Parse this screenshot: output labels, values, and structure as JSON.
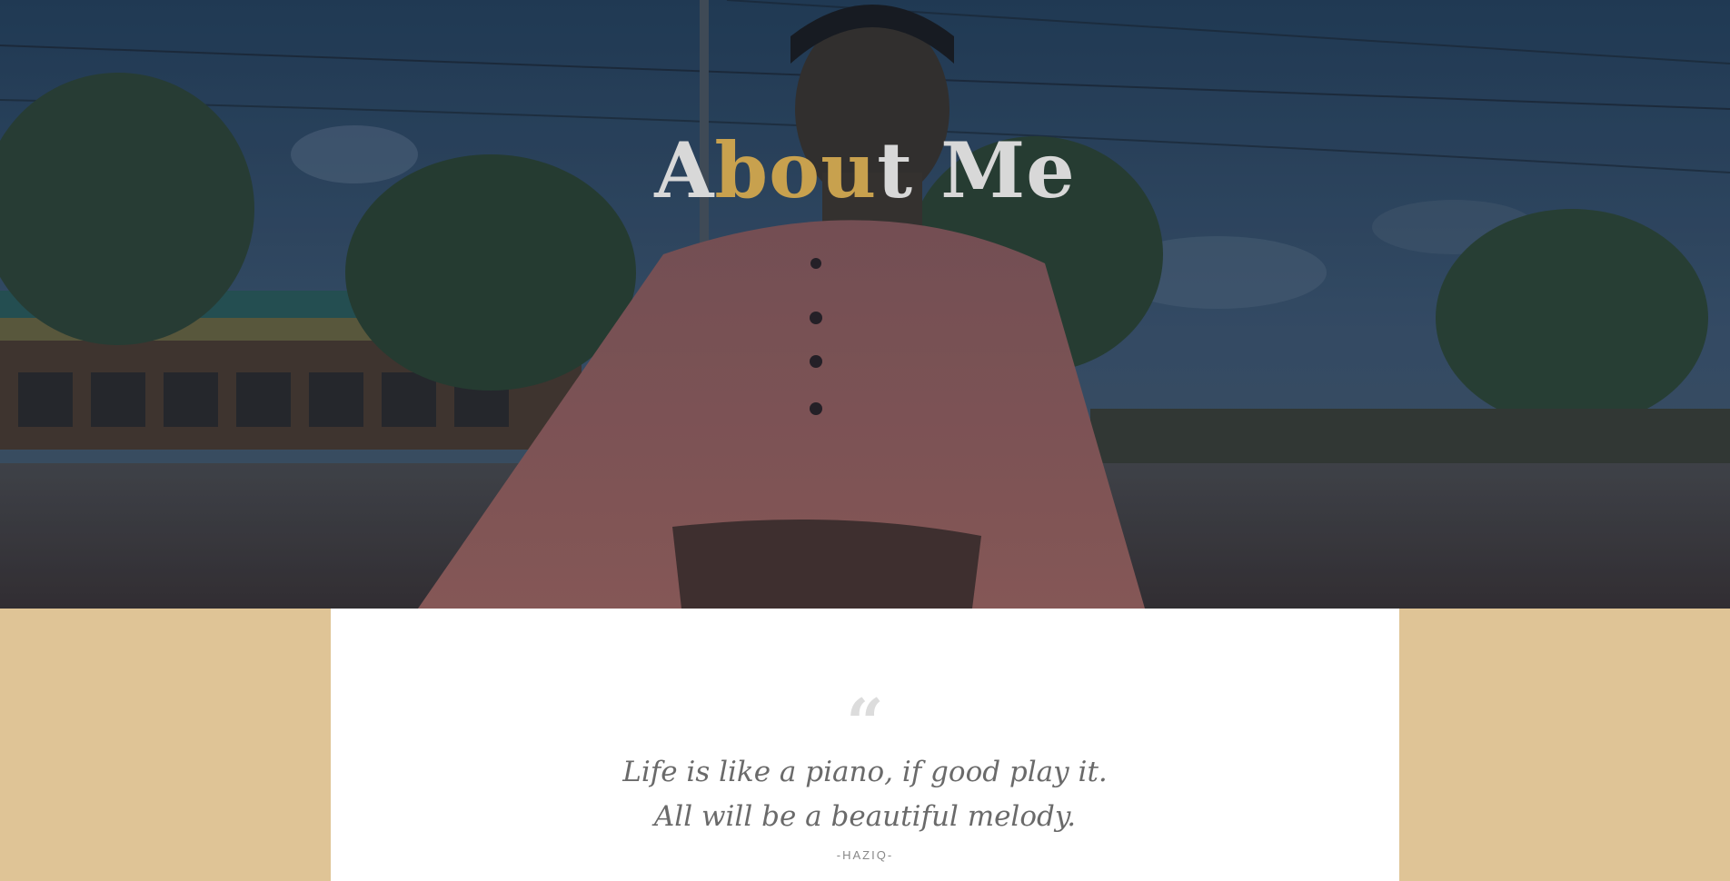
{
  "hero": {
    "title_part1": "A",
    "title_accent": "bou",
    "title_part2": "t Me"
  },
  "quote": {
    "mark": "“",
    "line1": "Life is like a piano, if good play it.",
    "line2": "All will be a beautiful melody.",
    "author": "-HAZIQ-"
  },
  "colors": {
    "accent": "#c8a14e",
    "side_panel": "#dfc496",
    "quote_bg": "#ffffff",
    "quote_text": "#6a6a6a"
  }
}
